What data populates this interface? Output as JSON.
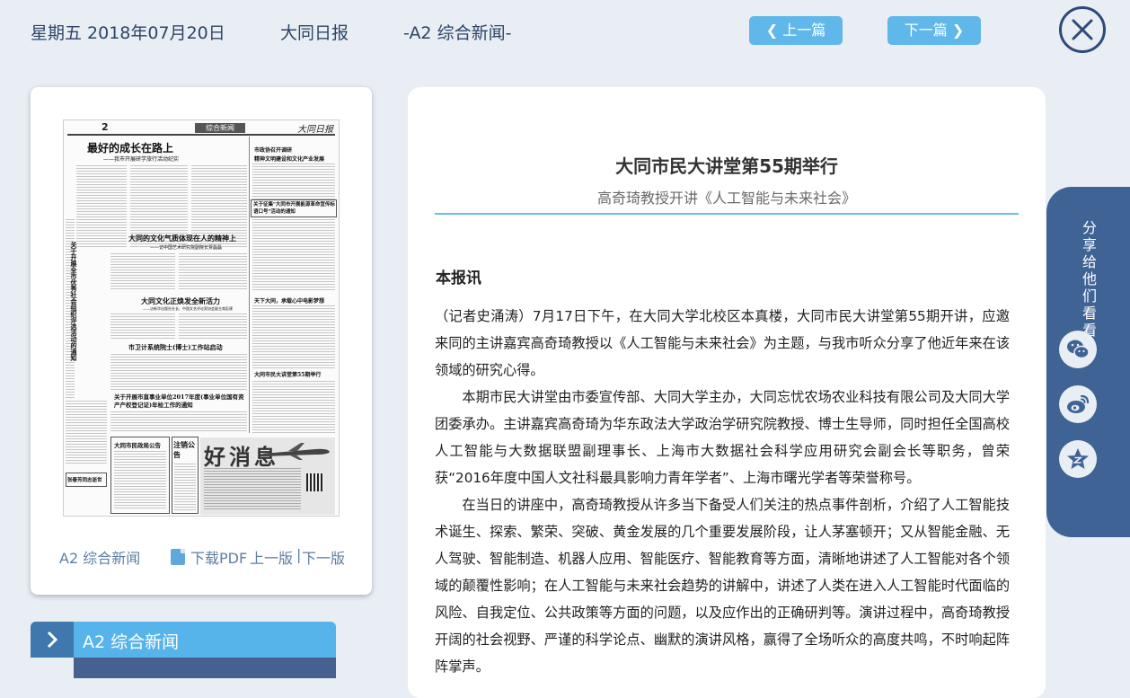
{
  "header": {
    "date": "星期五 2018年07月20日",
    "paper_name": "大同日报",
    "page_label": "-A2 综合新闻-",
    "prev_label": "上一篇",
    "next_label": "下一篇"
  },
  "thumbnail": {
    "page_caption": "A2 综合新闻",
    "download_pdf": "下载PDF",
    "prev_page": "上一版",
    "separator": "|",
    "next_page": "下一版",
    "newspaper": {
      "page_number": "2",
      "section": "综合新闻",
      "masthead": "大同日报",
      "headline_main": "最好的成长在路上",
      "headline_main_sub": "——我市开展研学旅行活动纪实",
      "headline_culture": "大同的文化气质体现在人的精神上",
      "headline_culture_sub": "——访中国艺术研究院副院长贾磊磊",
      "headline_industry": "大同文化正焕发全新活力",
      "headline_industry_sub": "——访新华出版社社长、中国文艺评论家协会副主席彭建",
      "headline_county": "市卫计系统院士(博士)工作站启动",
      "headline_notice": "关于开展市直事业单位2017年度(事业单位国有资产产权登记证)年检工作的通知",
      "right_head_1": "市政协召开调研",
      "right_head_2": "精神文明建设和文化产业发展",
      "right_head_3": "关于征集\"大同市开展能源革命宣传标语口号\"活动的通知",
      "right_head_4": "天下大同，承载心中电影梦想",
      "right_head_5": "大同市民大讲堂第55期举行",
      "left_vertical": "关于开展全市优秀社会组织评选活动的通知",
      "bottom_box_1": "大同市民政局公告",
      "bottom_box_2": "注销公告",
      "bottom_box_3": "张春芳同志逝世",
      "ad_title": "好消息"
    }
  },
  "section_tab": {
    "label": "A2  综合新闻"
  },
  "article": {
    "title": "大同市民大讲堂第55期举行",
    "subtitle": "高奇琦教授开讲《人工智能与未来社会》",
    "dateline": "本报讯",
    "paragraphs": [
      "（记者史涌涛）7月17日下午，在大同大学北校区本真楼，大同市民大讲堂第55期开讲，应邀来同的主讲嘉宾高奇琦教授以《人工智能与未来社会》为主题，与我市听众分享了他近年来在该领域的研究心得。",
      "本期市民大讲堂由市委宣传部、大同大学主办，大同忘忧农场农业科技有限公司及大同大学团委承办。主讲嘉宾高奇琦为华东政法大学政治学研究院教授、博士生导师，同时担任全国高校人工智能与大数据联盟副理事长、上海市大数据社会科学应用研究会副会长等职务，曾荣获“2016年度中国人文社科最具影响力青年学者”、上海市曙光学者等荣誉称号。",
      "在当日的讲座中，高奇琦教授从许多当下备受人们关注的热点事件剖析，介绍了人工智能技术诞生、探索、繁荣、突破、黄金发展的几个重要发展阶段，让人茅塞顿开；又从智能金融、无人驾驶、智能制造、机器人应用、智能医疗、智能教育等方面，清晰地讲述了人工智能对各个领域的颠覆性影响；在人工智能与未来社会趋势的讲解中，讲述了人类在进入人工智能时代面临的风险、自我定位、公共政策等方面的问题，以及应作出的正确研判等。演讲过程中，高奇琦教授开阔的社会视野、严谨的科学论点、幽默的演讲风格，赢得了全场听众的高度共鸣，不时响起阵阵掌声。"
    ]
  },
  "share": {
    "label": "分享给他们看看",
    "icons": [
      "wechat-icon",
      "weibo-icon",
      "favorite-icon"
    ]
  },
  "colors": {
    "background": "#e8eef4",
    "accent": "#5fb7ea",
    "share_panel": "#3f6394",
    "title_rule": "#6bbfe9"
  }
}
